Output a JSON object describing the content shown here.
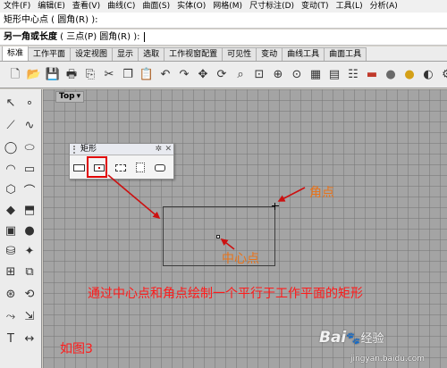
{
  "menubar": {
    "items": [
      "文件(F)",
      "编辑(E)",
      "查看(V)",
      "曲线(C)",
      "曲面(S)",
      "实体(O)",
      "网格(M)",
      "尺寸标注(D)",
      "变动(T)",
      "工具(L)",
      "分析(A)"
    ]
  },
  "command": {
    "line1": "矩形中心点 ( 圆角(R) ):",
    "line2_bold": "另一角或长度",
    "line2_rest": " ( 三点(P)  圆角(R) ): "
  },
  "tabs": [
    "标准",
    "工作平面",
    "设定视图",
    "显示",
    "选取",
    "工作视窗配置",
    "可见性",
    "变动",
    "曲线工具",
    "曲面工具"
  ],
  "toolbar": {
    "icons": [
      "new-file-icon",
      "open-folder-icon",
      "save-icon",
      "print-icon",
      "import-icon",
      "cut-icon",
      "copy-icon",
      "paste-icon",
      "undo-icon",
      "redo-icon",
      "pan-icon",
      "rotate-view-icon",
      "zoom-icon",
      "zoom-window-icon",
      "zoom-extents-icon",
      "zoom-selected-icon",
      "grid-icon",
      "layers-icon",
      "properties-icon",
      "car-render-icon",
      "sphere-render-icon",
      "bulb-icon",
      "shade-icon",
      "options-icon"
    ]
  },
  "sidebar": {
    "icons": [
      "select-icon",
      "point-icon",
      "polyline-icon",
      "curve-icon",
      "circle-icon",
      "ellipse-icon",
      "arc-icon",
      "rectangle-icon",
      "polygon-icon",
      "fillet-curve-icon",
      "surface-icon",
      "extrude-icon",
      "box-icon",
      "sphere-icon",
      "cylinder-icon",
      "boolean-icon",
      "mesh-icon",
      "explode-icon",
      "move-icon",
      "rotate-icon",
      "bend-icon",
      "scale-icon",
      "text-icon",
      "dimension-icon"
    ]
  },
  "viewport": {
    "label": "Top",
    "dropdown_glyph": "▾"
  },
  "palette": {
    "title": "矩形",
    "gear_glyph": "✲",
    "close_glyph": "✕",
    "buttons": [
      "rectangle-corner-icon",
      "rectangle-center-icon",
      "rectangle-3point-icon",
      "rectangle-vertical-icon",
      "rounded-rectangle-icon"
    ]
  },
  "annotations": {
    "corner_label": "角点",
    "center_label": "中心点",
    "caption": "通过中心点和角点绘制一个平行于工作平面的矩形",
    "figure": "如图3",
    "colors": {
      "orange": "#e8731a",
      "red": "#ff1a1a",
      "arrow": "#cc1111"
    }
  },
  "watermark": {
    "brand_left": "Bai",
    "brand_right": "经验",
    "url": "jingyan.baidu.com"
  }
}
